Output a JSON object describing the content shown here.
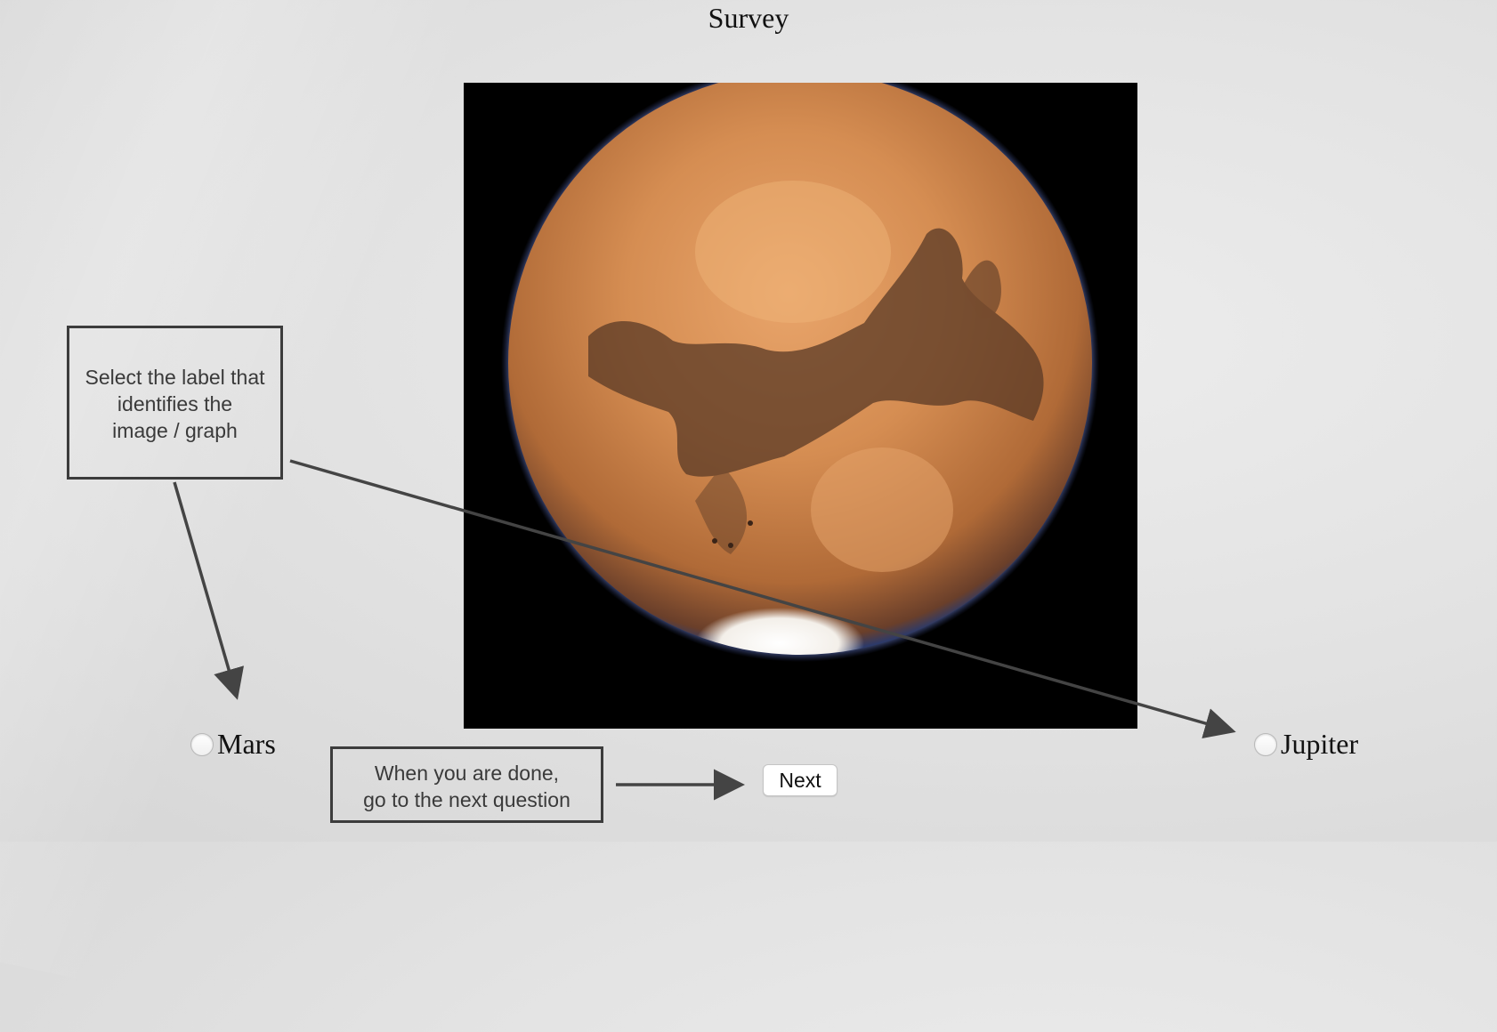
{
  "page": {
    "title": "Survey"
  },
  "image": {
    "subject": "Mars"
  },
  "callouts": {
    "select_label": [
      "Select the label that",
      "identifies the",
      "image / graph"
    ],
    "next_instruction": [
      "When you are done,",
      "go to the next question"
    ]
  },
  "options": [
    {
      "label": "Mars",
      "selected": false
    },
    {
      "label": "Jupiter",
      "selected": false
    }
  ],
  "navigation": {
    "next_label": "Next"
  },
  "colors": {
    "callout_border": "#3c3c3c",
    "arrow": "#444444",
    "planet_orange": "#c97c43",
    "photo_background": "#000000"
  }
}
